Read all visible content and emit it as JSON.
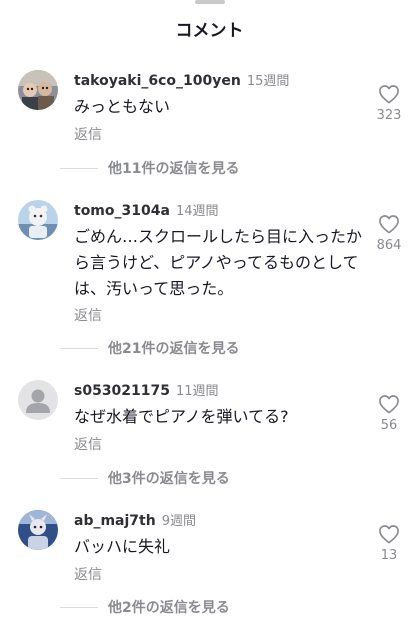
{
  "header": {
    "title": "コメント"
  },
  "comments": [
    {
      "username": "takoyaki_6co_100yen",
      "age": "15週間",
      "text": "みっともない",
      "reply_label": "返信",
      "likes": "323",
      "view_replies": "他11件の返信を見る",
      "avatar": "photo-avatar"
    },
    {
      "username": "tomo_3104a",
      "age": "14週間",
      "text": "ごめん…スクロールしたら目に入ったから言うけど、ピアノやってるものとしては、汚いって思った。",
      "reply_label": "返信",
      "likes": "864",
      "view_replies": "他21件の返信を見る",
      "avatar": "illustration-avatar"
    },
    {
      "username": "s053021175",
      "age": "11週間",
      "text": "なぜ水着でピアノを弾いてる?",
      "reply_label": "返信",
      "likes": "56",
      "view_replies": "他3件の返信を見る",
      "avatar": "default-avatar"
    },
    {
      "username": "ab_maj7th",
      "age": "9週間",
      "text": "バッハに失礼",
      "reply_label": "返信",
      "likes": "13",
      "view_replies": "他2件の返信を見る",
      "avatar": "illustration-avatar"
    }
  ],
  "colors": {
    "text": "#161823",
    "muted": "#8a8b91",
    "divider": "#dcdcdf"
  },
  "icons": {
    "like": "heart-outline-icon"
  }
}
